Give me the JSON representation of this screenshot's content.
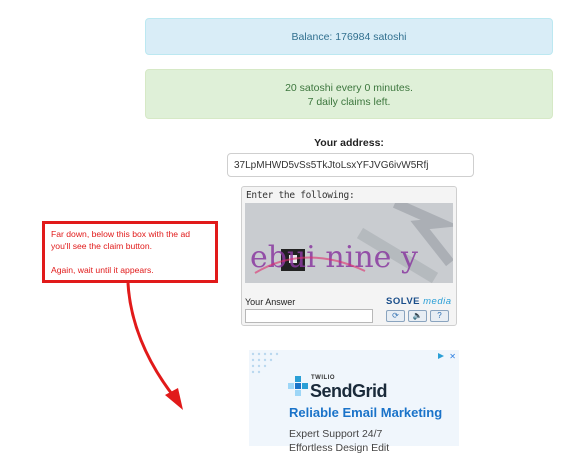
{
  "balance": {
    "text": "Balance: 176984 satoshi"
  },
  "claims": {
    "line1": "20 satoshi every 0 minutes.",
    "line2": "7 daily claims left."
  },
  "address": {
    "label": "Your address:",
    "value": "37LpMHWD5vSs5TkJtoLsxYFJVG6ivW5Rfj"
  },
  "captcha": {
    "prompt": "Enter the following:",
    "challenge_text": "ebui nine y",
    "answer_label": "Your Answer",
    "answer_value": "",
    "brand_solve": "SOLVE",
    "brand_media": "media",
    "buttons": [
      {
        "icon": "refresh-icon",
        "glyph": "⟳"
      },
      {
        "icon": "audio-icon",
        "glyph": "🔈"
      },
      {
        "icon": "help-icon",
        "glyph": "?"
      }
    ]
  },
  "annotation": {
    "line1": "Far down, below this box with the ad",
    "line2": "you'll see the claim button.",
    "line3": "Again, wait until it appears.",
    "color": "#e11a1a"
  },
  "ad": {
    "parent_brand": "TWILIO",
    "brand": "SendGrid",
    "headline": "Reliable Email Marketing",
    "line1": "Expert Support 24/7",
    "line2": "Effortless Design Edit",
    "close_glyph": "✕"
  },
  "colors": {
    "info_bg": "#d9edf7",
    "success_bg": "#dff0d8",
    "ad_accent": "#1a73c9"
  }
}
